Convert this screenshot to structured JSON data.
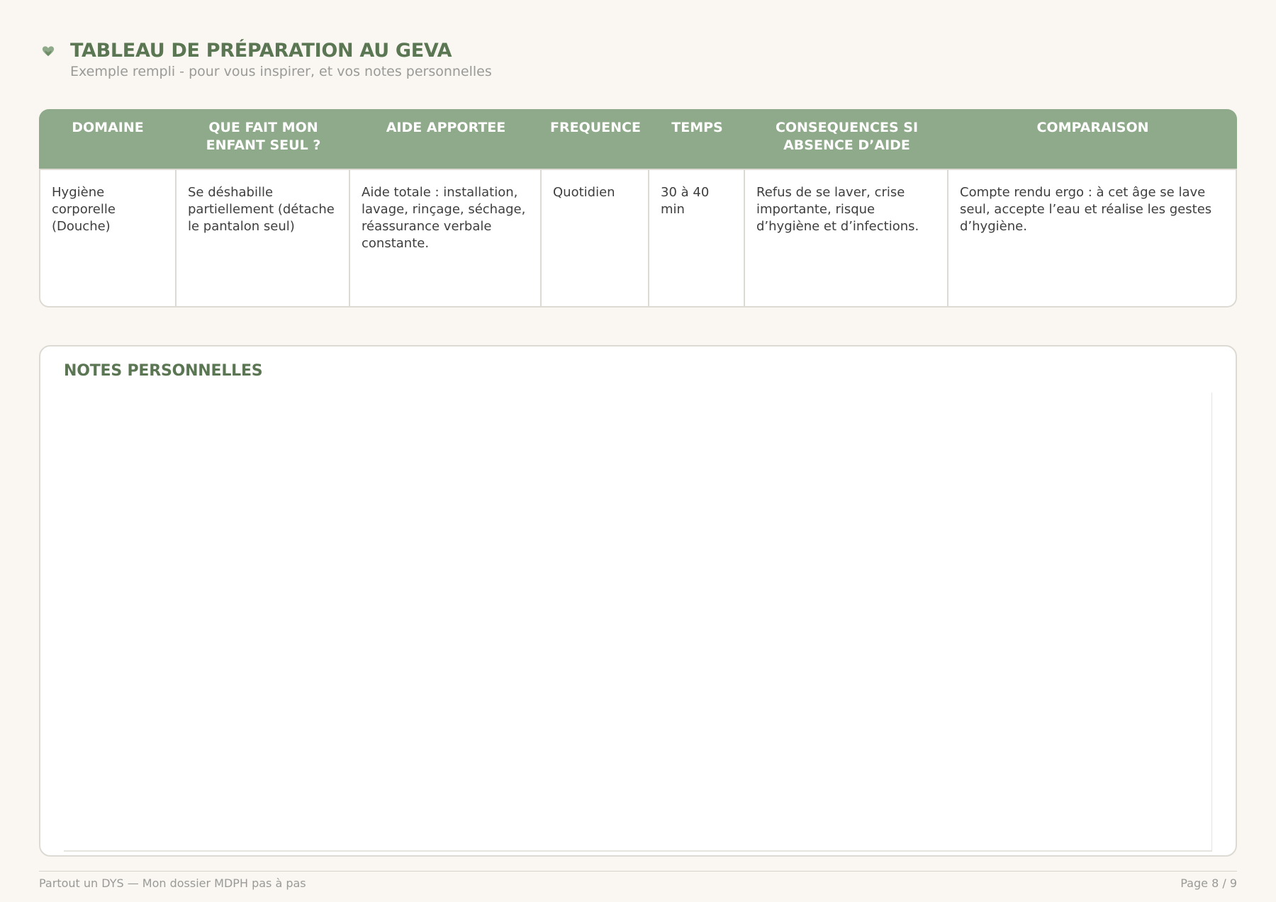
{
  "header": {
    "title": "TABLEAU DE PRÉPARATION AU GEVA",
    "subtitle": "Exemple rempli - pour vous inspirer, et vos notes personnelles",
    "icon": "heart-icon"
  },
  "table": {
    "columns": [
      "DOMAINE",
      "QUE FAIT MON ENFANT SEUL ?",
      "AIDE APPORTEE",
      "FREQUENCE",
      "TEMPS",
      "CONSEQUENCES SI ABSENCE D’AIDE",
      "COMPARAISON"
    ],
    "rows": [
      [
        "Hygiène corporelle (Douche)",
        "Se déshabille partiellement (détache le pantalon seul)",
        "Aide totale : installation, lavage, rinçage, séchage, réassurance verbale constante.",
        "Quotidien",
        "30 à 40 min",
        "Refus de se laver, crise importante, risque d’hygiène et d’infections.",
        "Compte rendu ergo : à cet âge se lave seul, accepte l’eau et réalise les gestes d’hygiène."
      ]
    ]
  },
  "notes": {
    "title": "NOTES PERSONNELLES"
  },
  "footer": {
    "left": "Partout un DYS — Mon dossier MDPH pas à pas",
    "right": "Page 8 / 9"
  },
  "colors": {
    "accent": "#5b7653",
    "header_bg": "#8faa8a",
    "page_bg": "#faf7f2",
    "muted_text": "#9a9a97"
  }
}
